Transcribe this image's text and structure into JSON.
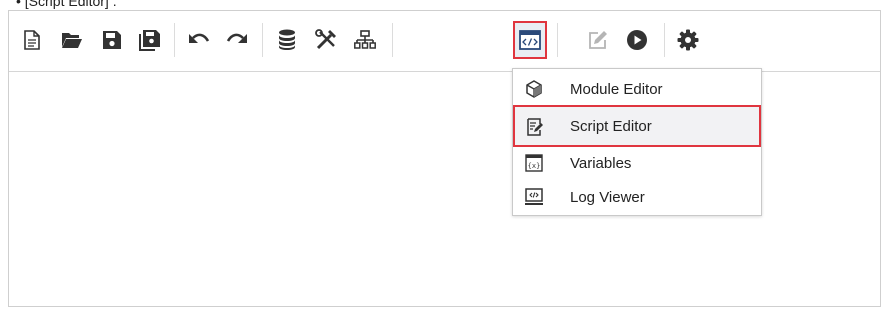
{
  "caption": "• [Script Editor] .",
  "toolbar": {
    "buttons": [
      {
        "name": "new-file-icon"
      },
      {
        "name": "open-folder-icon"
      },
      {
        "name": "save-icon"
      },
      {
        "name": "save-all-icon"
      },
      {
        "name": "undo-icon"
      },
      {
        "name": "redo-icon"
      },
      {
        "name": "database-icon"
      },
      {
        "name": "tools-icon"
      },
      {
        "name": "hierarchy-icon"
      },
      {
        "name": "code-window-icon"
      },
      {
        "name": "edit-icon"
      },
      {
        "name": "run-icon"
      },
      {
        "name": "settings-gear-icon"
      }
    ]
  },
  "menu": {
    "items": [
      {
        "label": "Module Editor",
        "icon": "module-cube-icon"
      },
      {
        "label": "Script Editor",
        "icon": "script-edit-icon",
        "selected": true
      },
      {
        "label": "Variables",
        "icon": "variables-icon"
      },
      {
        "label": "Log Viewer",
        "icon": "log-viewer-icon"
      }
    ]
  },
  "colors": {
    "highlight_border": "#e0353f",
    "icon": "#333333",
    "icon_disabled": "#b5b5b5"
  }
}
